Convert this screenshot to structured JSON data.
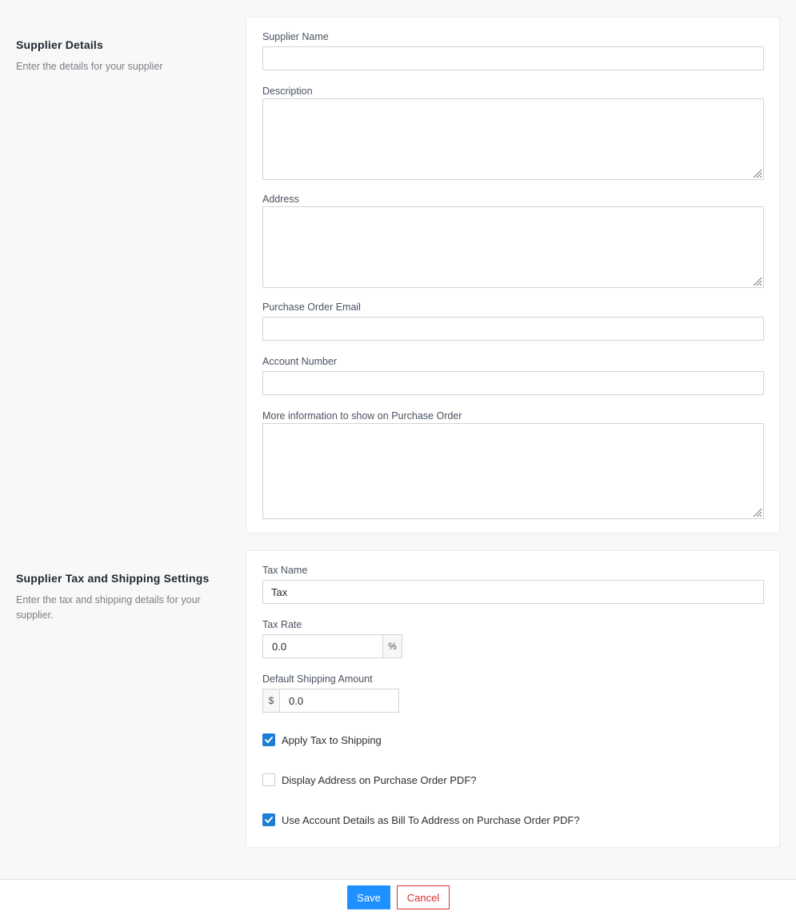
{
  "supplier_details": {
    "title": "Supplier Details",
    "description": "Enter the details for your supplier",
    "fields": {
      "supplier_name": {
        "label": "Supplier Name",
        "value": ""
      },
      "description": {
        "label": "Description",
        "value": ""
      },
      "address": {
        "label": "Address",
        "value": ""
      },
      "po_email": {
        "label": "Purchase Order Email",
        "value": ""
      },
      "account_number": {
        "label": "Account Number",
        "value": ""
      },
      "more_info": {
        "label": "More information to show on Purchase Order",
        "value": ""
      }
    }
  },
  "tax_shipping": {
    "title": "Supplier Tax and Shipping Settings",
    "description": "Enter the tax and shipping details for your supplier.",
    "tax_name": {
      "label": "Tax Name",
      "value": "Tax"
    },
    "tax_rate": {
      "label": "Tax Rate",
      "value": "0.0",
      "suffix": "%"
    },
    "default_shipping": {
      "label": "Default Shipping Amount",
      "value": "0.0",
      "prefix": "$"
    },
    "checkboxes": [
      {
        "label": "Apply Tax to Shipping",
        "checked": true
      },
      {
        "label": "Display Address on Purchase Order PDF?",
        "checked": false
      },
      {
        "label": "Use Account Details as Bill To Address on Purchase Order PDF?",
        "checked": true
      }
    ]
  },
  "footer": {
    "save_label": "Save",
    "cancel_label": "Cancel"
  },
  "colors": {
    "primary": "#1e90ff",
    "danger": "#d9302c",
    "checkbox": "#1a7fd4"
  }
}
